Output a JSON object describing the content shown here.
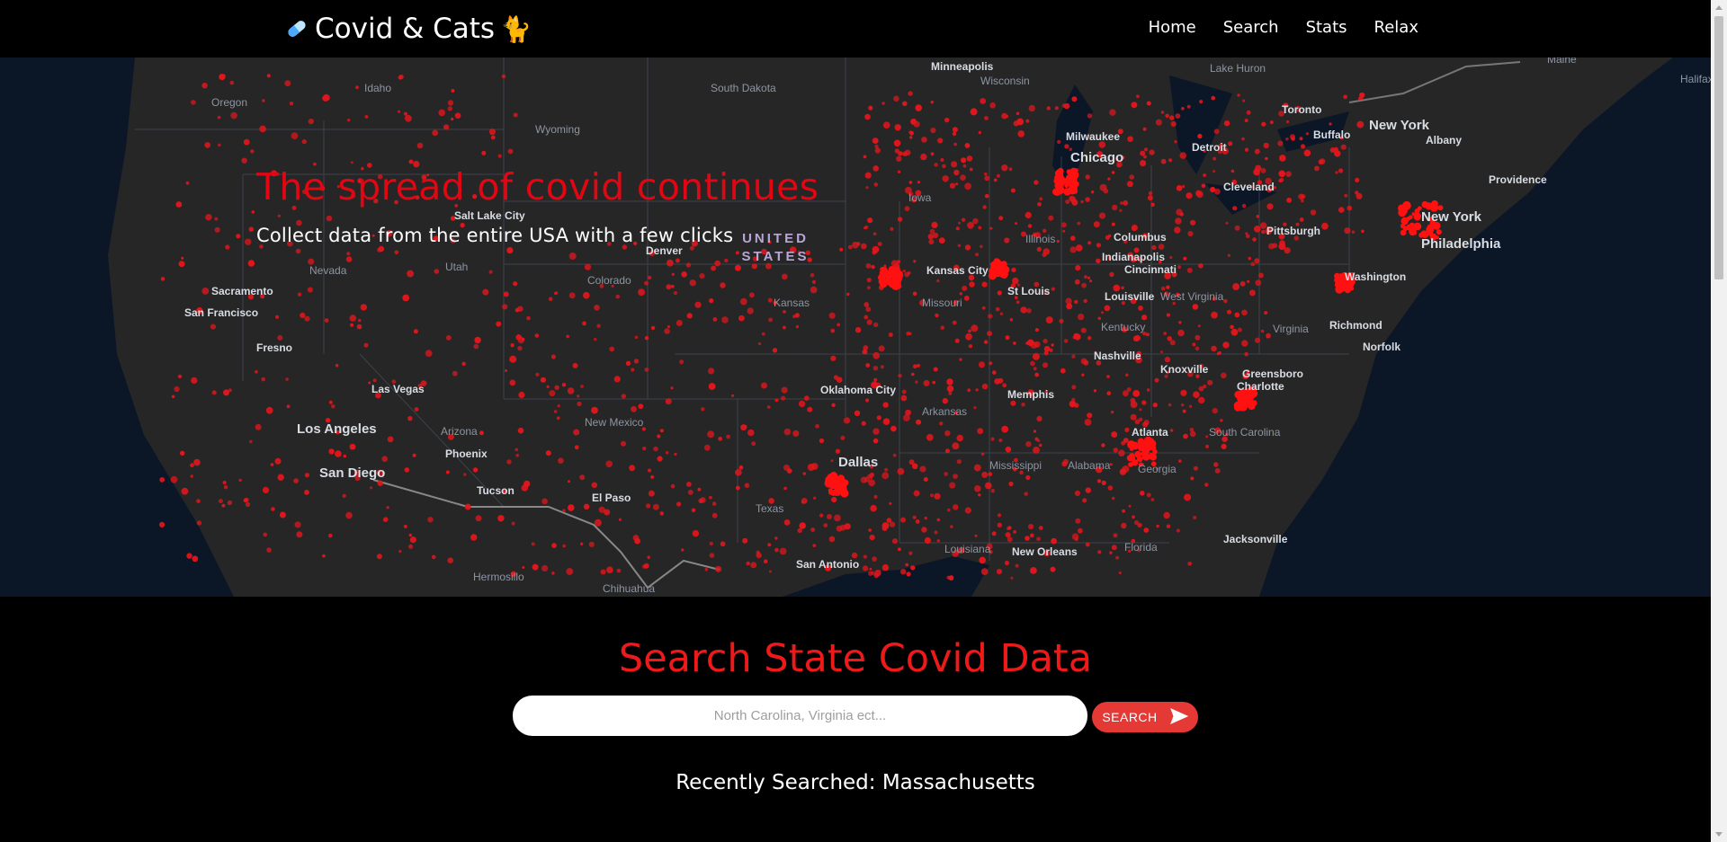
{
  "navbar": {
    "brand": "Covid & Cats",
    "pill_icon": "pill-icon",
    "cat_icon": "cat-icon",
    "links": [
      "Home",
      "Search",
      "Stats",
      "Relax"
    ]
  },
  "hero": {
    "title": "The spread of covid continues",
    "subtitle": "Collect data from the entire USA with a few clicks",
    "map_labels": [
      "Minneapolis",
      "Wisconsin",
      "South Dakota",
      "Idaho",
      "Oregon",
      "Wyoming",
      "Milwaukee",
      "Chicago",
      "Detroit",
      "Toronto",
      "Buffalo",
      "New York",
      "Albany",
      "Providence",
      "Cleveland",
      "Pittsburgh",
      "Philadelphia",
      "New York",
      "Iowa",
      "Illinois",
      "Indianapolis",
      "Columbus",
      "Cincinnati",
      "West Virginia",
      "Washington",
      "Richmond",
      "Norfolk",
      "Virginia",
      "Kentucky",
      "Louisville",
      "St Louis",
      "Missouri",
      "Kansas City",
      "Kansas",
      "Colorado",
      "Denver",
      "Utah",
      "Salt Lake City",
      "Nevada",
      "Sacramento",
      "San Francisco",
      "Fresno",
      "Las Vegas",
      "Los Angeles",
      "San Diego",
      "Arizona",
      "Phoenix",
      "Tucson",
      "New Mexico",
      "El Paso",
      "Oklahoma City",
      "Arkansas",
      "Memphis",
      "Nashville",
      "Knoxville",
      "Greensboro",
      "Charlotte",
      "Atlanta",
      "South Carolina",
      "Georgia",
      "Alabama",
      "Mississippi",
      "Dallas",
      "Texas",
      "San Antonio",
      "Louisiana",
      "New Orleans",
      "Florida",
      "Jacksonville",
      "Hermosillo",
      "Chihuahua",
      "Lake Huron",
      "Maine",
      "Halifax"
    ],
    "country_label_line1": "UNITED",
    "country_label_line2": "STATES"
  },
  "search": {
    "title": "Search State Covid Data",
    "placeholder": "North Carolina, Virginia ect...",
    "button_label": "SEARCH",
    "recent_label": "Recently Searched: Massachusetts"
  }
}
